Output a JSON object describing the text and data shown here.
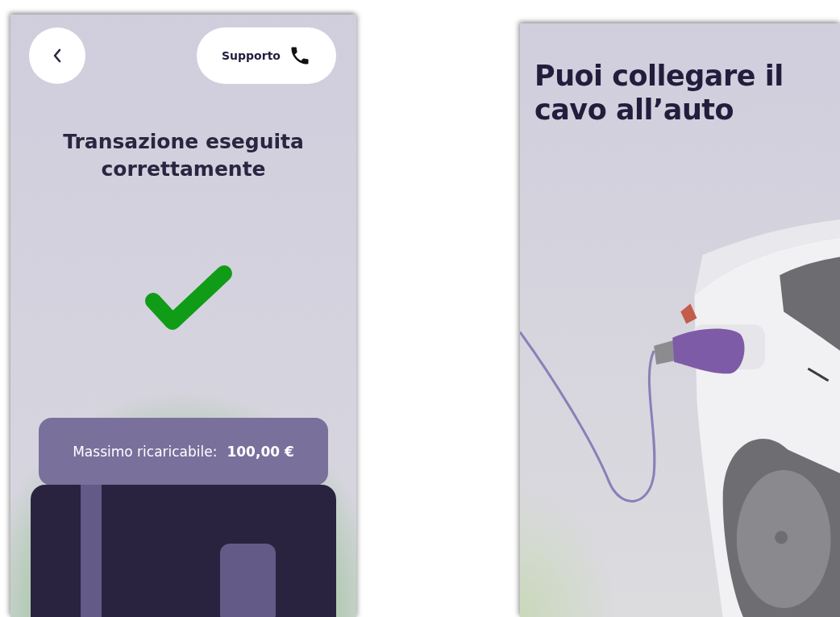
{
  "payment_screen": {
    "support_button": {
      "label": "Supporto"
    },
    "title": "Transazione eseguita correttamente",
    "limit": {
      "label": "Massimo ricaricabile:",
      "value": "100,00 €"
    }
  },
  "plug_screen": {
    "title": "Puoi collegare il cavo all’auto"
  }
}
